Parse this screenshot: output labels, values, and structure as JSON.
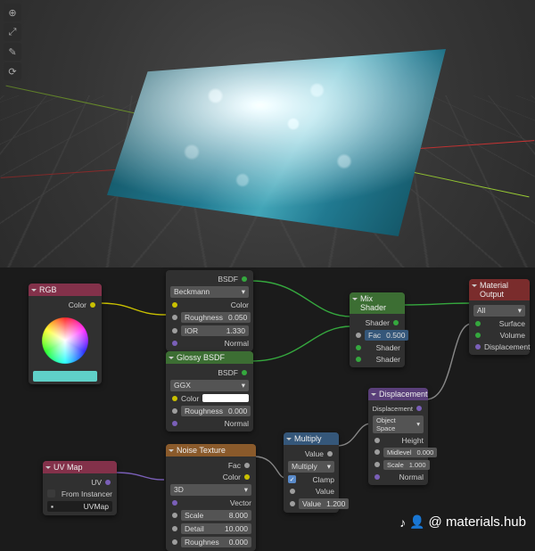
{
  "viewport_tools": [
    "⊕",
    "⤢",
    "✎",
    "⟳"
  ],
  "nodes": {
    "rgb": {
      "title": "RGB",
      "out_color": "Color",
      "swatch": "#5fd0c8"
    },
    "uvmap": {
      "title": "UV Map",
      "out_uv": "UV",
      "from_instancer": "From Instancer",
      "map_name": "UVMap"
    },
    "glass": {
      "out_bsdf": "BSDF",
      "dist": "Beckmann",
      "color_lbl": "Color",
      "rough_lbl": "Roughness",
      "rough_val": "0.050",
      "ior_lbl": "IOR",
      "ior_val": "1.330",
      "normal_lbl": "Normal"
    },
    "glossy": {
      "title": "Glossy BSDF",
      "out_bsdf": "BSDF",
      "dist": "GGX",
      "color_lbl": "Color",
      "rough_lbl": "Roughness",
      "rough_val": "0.000",
      "normal_lbl": "Normal"
    },
    "noise": {
      "title": "Noise Texture",
      "out_fac": "Fac",
      "out_color": "Color",
      "dim": "3D",
      "vector_lbl": "Vector",
      "scale_lbl": "Scale",
      "scale_val": "8.000",
      "detail_lbl": "Detail",
      "detail_val": "10.000",
      "rough_lbl": "Roughnes",
      "rough_val": "0.000"
    },
    "multiply": {
      "title": "Multiply",
      "out_value": "Value",
      "op": "Multiply",
      "clamp": "Clamp",
      "in_value1": "Value",
      "val2_lbl": "Value",
      "val2_val": "1.200"
    },
    "mix": {
      "title": "Mix Shader",
      "out_shader": "Shader",
      "fac_lbl": "Fac",
      "fac_val": "0.500",
      "in_shader1": "Shader",
      "in_shader2": "Shader"
    },
    "disp": {
      "title": "Displacement",
      "out_disp": "Displacement",
      "space": "Object Space",
      "height_lbl": "Height",
      "mid_lbl": "Midlevel",
      "mid_val": "0.000",
      "scale_lbl": "Scale",
      "scale_val": "1.000",
      "normal_lbl": "Normal"
    },
    "output": {
      "title": "Material Output",
      "target": "All",
      "surface": "Surface",
      "volume": "Volume",
      "displacement": "Displacement"
    }
  },
  "watermark": {
    "handle": "@ materials.hub"
  }
}
